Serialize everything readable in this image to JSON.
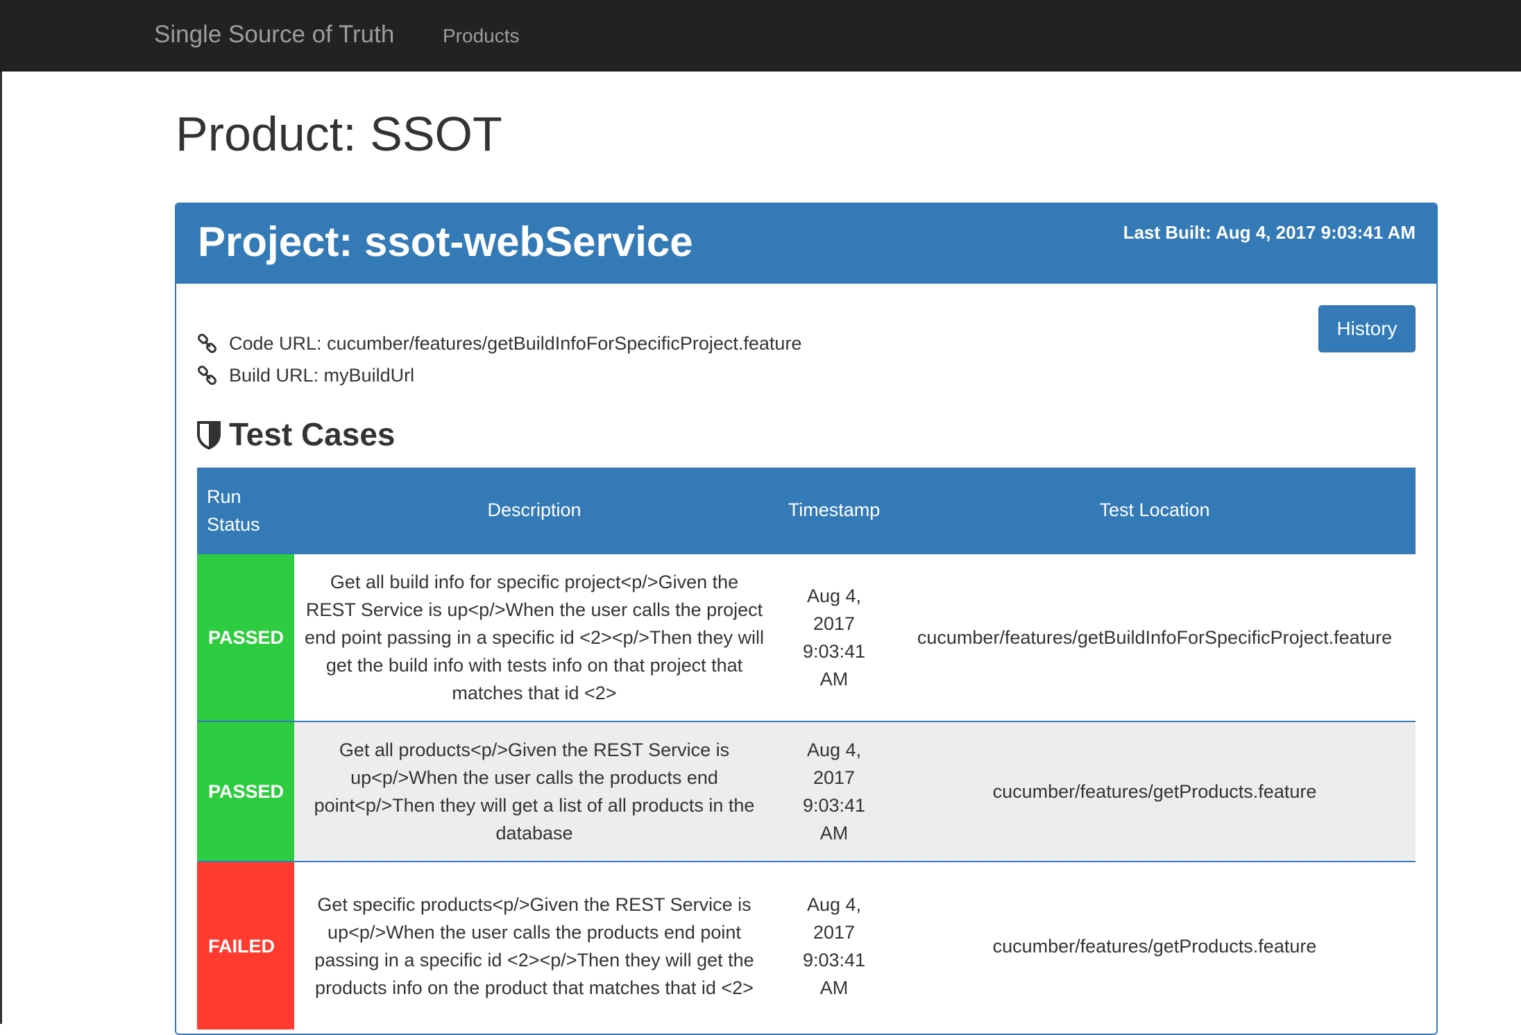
{
  "navbar": {
    "brand": "Single Source of Truth",
    "links": [
      "Products"
    ]
  },
  "page": {
    "title": "Product: SSOT"
  },
  "project": {
    "title": "Project: ssot-webService",
    "last_built": "Last Built: Aug 4, 2017 9:03:41 AM",
    "code_url": "Code URL: cucumber/features/getBuildInfoForSpecificProject.feature",
    "build_url": "Build URL: myBuildUrl",
    "history_label": "History",
    "accent_color": "#337ab7"
  },
  "test_cases": {
    "heading": "Test Cases",
    "columns": {
      "status_line1": "Run",
      "status_line2": "Status",
      "description": "Description",
      "timestamp": "Timestamp",
      "location": "Test Location"
    },
    "rows": [
      {
        "status": "PASSED",
        "description": "Get all build info for specific project<p/>Given the REST Service is up<p/>When the user calls the project end point passing in a specific id <2><p/>Then they will get the build info with tests info on that project that matches that id <2>",
        "timestamp_line1": "Aug 4,",
        "timestamp_line2": "2017",
        "timestamp_line3": "9:03:41",
        "timestamp_line4": "AM",
        "location": "cucumber/features/getBuildInfoForSpecificProject.feature"
      },
      {
        "status": "PASSED",
        "description": "Get all products<p/>Given the REST Service is up<p/>When the user calls the products end point<p/>Then they will get a list of all products in the database",
        "timestamp_line1": "Aug 4,",
        "timestamp_line2": "2017",
        "timestamp_line3": "9:03:41",
        "timestamp_line4": "AM",
        "location": "cucumber/features/getProducts.feature"
      },
      {
        "status": "FAILED",
        "description": "Get specific products<p/>Given the REST Service is up<p/>When the user calls the products end point passing in a specific id <2><p/>Then they will get the products info on the product that matches that id <2>",
        "timestamp_line1": "Aug 4,",
        "timestamp_line2": "2017",
        "timestamp_line3": "9:03:41",
        "timestamp_line4": "AM",
        "location": "cucumber/features/getProducts.feature"
      }
    ],
    "status_colors": {
      "PASSED": "#2ecc40",
      "FAILED": "#ff3b30"
    }
  }
}
